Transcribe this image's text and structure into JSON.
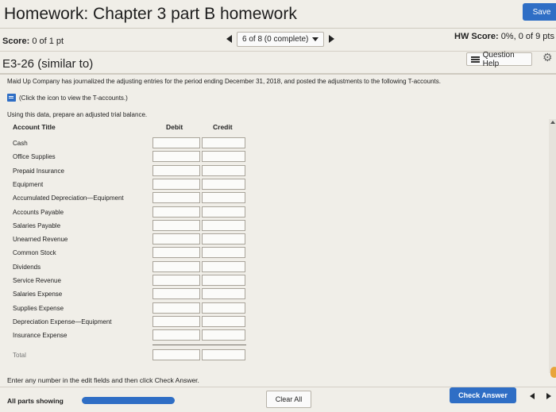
{
  "header": {
    "title": "Homework: Chapter 3 part B homework",
    "save_label": "Save"
  },
  "score": {
    "label": "Score:",
    "value": "0 of 1 pt"
  },
  "pager": {
    "text": "6 of 8 (0 complete)"
  },
  "hw_score": {
    "label": "HW Score:",
    "value": "0%, 0 of 9 pts"
  },
  "question": {
    "id": "E3-26 (similar to)",
    "help_label": "Question Help",
    "prompt": "Maid Up Company has journalized the adjusting entries for the period ending December 31, 2018, and posted the adjustments to the following T-accounts.",
    "t_link": "(Click the icon to view the T-accounts.)",
    "instruction": "Using this data, prepare an adjusted trial balance."
  },
  "table": {
    "headers": {
      "account": "Account Title",
      "debit": "Debit",
      "credit": "Credit"
    },
    "rows": [
      "Cash",
      "Office Supplies",
      "Prepaid Insurance",
      "Equipment",
      "Accumulated Depreciation—Equipment",
      "Accounts Payable",
      "Salaries Payable",
      "Unearned Revenue",
      "Common Stock",
      "Dividends",
      "Service Revenue",
      "Salaries Expense",
      "Supplies Expense",
      "Depreciation Expense—Equipment",
      "Insurance Expense"
    ],
    "total_label": "Total"
  },
  "footer": {
    "enter_note": "Enter any number in the edit fields and then click Check Answer.",
    "parts_label": "All parts showing",
    "clear_label": "Clear All",
    "check_label": "Check Answer"
  },
  "colors": {
    "accent": "#2f6ec5",
    "background": "#f0eee8"
  },
  "icons": [
    "chevron-left-icon",
    "chevron-right-icon",
    "caret-down-icon",
    "list-icon",
    "gear-icon",
    "t-accounts-icon"
  ]
}
